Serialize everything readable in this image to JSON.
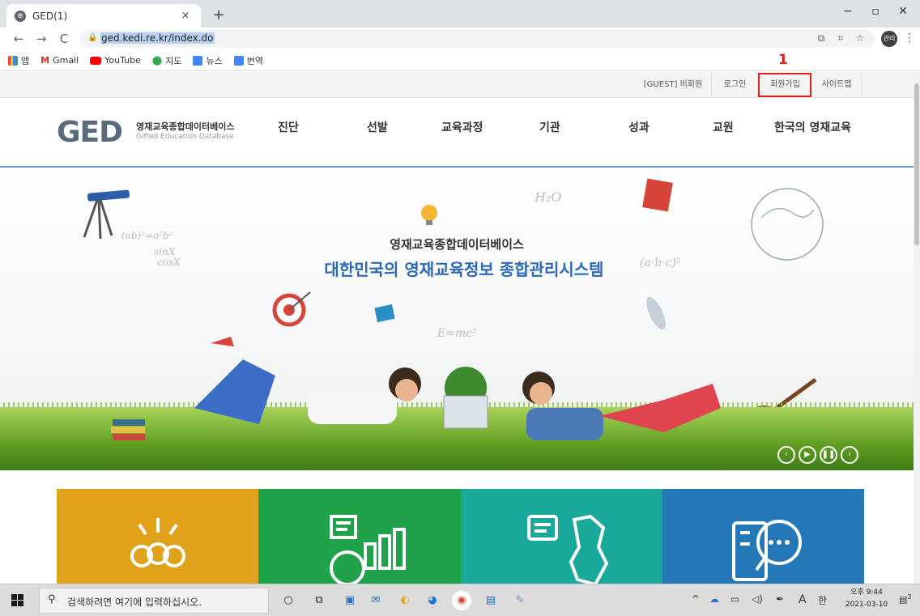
{
  "browser": {
    "tab_title": "GED(1)",
    "tab_close": "×",
    "new_tab": "+",
    "url": "ged.kedi.re.kr/index.do",
    "window_controls": {
      "minimize": "−",
      "maximize": "▫",
      "close": "✕"
    },
    "nav": {
      "back": "←",
      "forward": "→",
      "reload": "C"
    },
    "bookmarks": [
      {
        "label": "앱",
        "icon": "apps-grid-icon"
      },
      {
        "label": "Gmail",
        "icon": "gmail-icon"
      },
      {
        "label": "YouTube",
        "icon": "youtube-icon"
      },
      {
        "label": "지도",
        "icon": "maps-pin-icon"
      },
      {
        "label": "뉴스",
        "icon": "news-icon"
      },
      {
        "label": "번역",
        "icon": "translate-icon"
      }
    ],
    "profile_initials": "관리"
  },
  "site": {
    "util_links": [
      "[GUEST] 비회원",
      "로그인",
      "회원가입",
      "사이트맵"
    ],
    "annotation_number": "1",
    "logo": {
      "mark": "GED",
      "korean": "영재교육종합데이터베이스",
      "english": "Gifted Education Database"
    },
    "gnb": [
      "진단",
      "선발",
      "교육과정",
      "기관",
      "성과",
      "교원",
      "한국의 영재교육"
    ],
    "hero": {
      "subtitle": "영재교육종합데이터베이스",
      "title": "대한민국의 영재교육정보 종합관리시스템",
      "doodles": [
        "(ab)²=a²b²",
        "sinX",
        "cosX",
        "H₂O",
        "E=mc²",
        "(a·b·c)²"
      ]
    },
    "slider_controls": [
      "prev",
      "play",
      "pause",
      "next"
    ],
    "tiles": [
      {
        "color": "#e0a21b",
        "icon": "people-idea-icon"
      },
      {
        "color": "#1fa24a",
        "icon": "chart-document-icon"
      },
      {
        "color": "#18a99b",
        "icon": "korea-map-icon"
      },
      {
        "color": "#2478b8",
        "icon": "book-search-icon"
      }
    ]
  },
  "taskbar": {
    "search_placeholder": "검색하려면 여기에 입력하십시오.",
    "ime_a": "A",
    "ime_han": "한",
    "time": "오후 9:44",
    "date": "2021-03-10",
    "notifications": "3"
  }
}
